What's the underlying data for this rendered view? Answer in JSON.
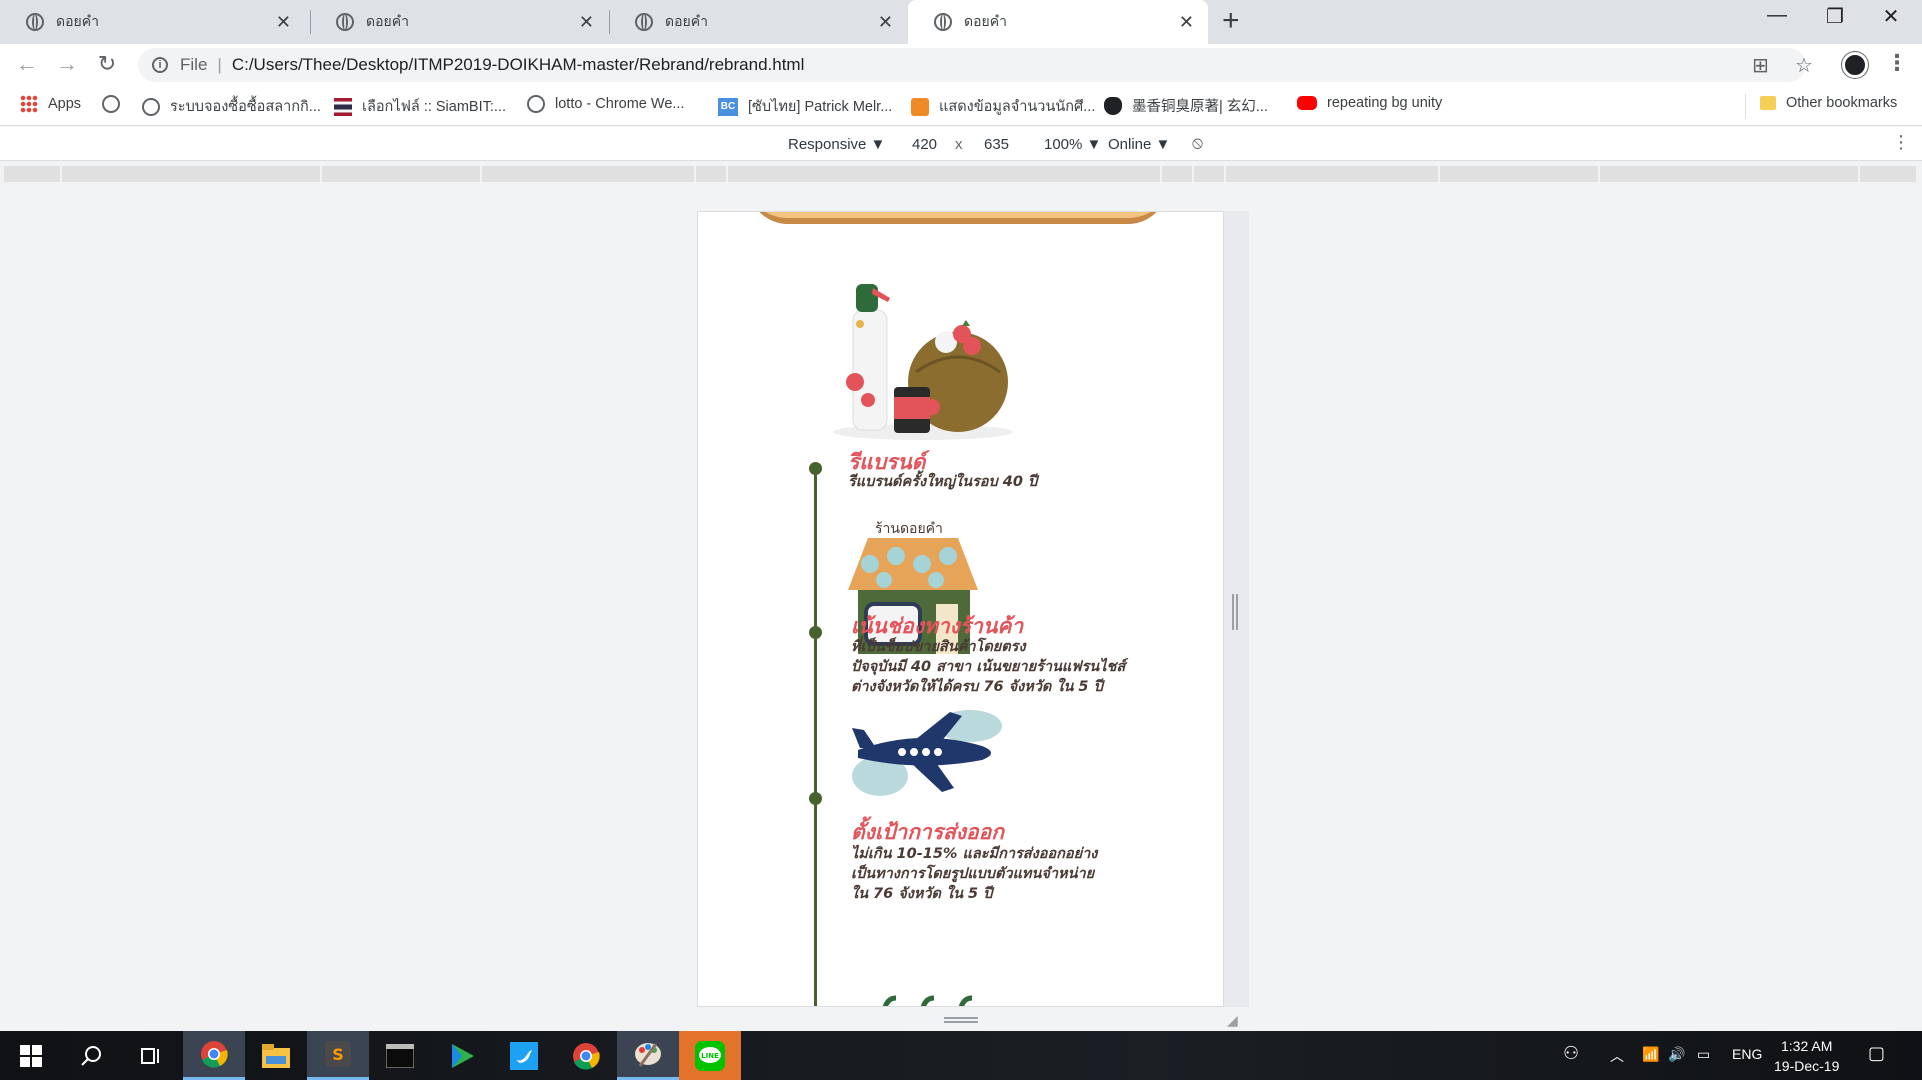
{
  "browser": {
    "tabs": [
      {
        "title": "ดอยคำ",
        "active": false
      },
      {
        "title": "ดอยคำ",
        "active": false
      },
      {
        "title": "ดอยคำ",
        "active": false
      },
      {
        "title": "ดอยคำ",
        "active": true
      }
    ],
    "new_tab_label": "+",
    "window_controls": {
      "minimize": "—",
      "restore": "❐",
      "close": "✕"
    },
    "address": {
      "scheme_label": "File",
      "url": "C:/Users/Thee/Desktop/ITMP2019-DOIKHAM-master/Rebrand/rebrand.html"
    },
    "bookmarks": [
      {
        "label": "Apps",
        "icon": "apps-icon"
      },
      {
        "label": "",
        "icon": "globe-icon"
      },
      {
        "label": "ระบบจองซื้อซื้อสลากกิ...",
        "icon": "globe-icon"
      },
      {
        "label": "เลือกไฟล์ :: SiamBIT:...",
        "icon": "thai-flag-icon"
      },
      {
        "label": "lotto - Chrome We...",
        "icon": "globe-icon"
      },
      {
        "label": "[ซับไทย] Patrick Melr...",
        "icon": "bc-icon"
      },
      {
        "label": "แสดงข้อมูลจำนวนนักศึ...",
        "icon": "orange-site-icon"
      },
      {
        "label": "墨香铜臭原著| 玄幻...",
        "icon": "cat-icon"
      },
      {
        "label": "repeating bg unity",
        "icon": "youtube-icon"
      }
    ],
    "other_bookmarks": "Other bookmarks"
  },
  "devtools": {
    "device": "Responsive ▼",
    "width": "420",
    "times": "x",
    "height": "635",
    "zoom": "100% ▼",
    "throttle": "Online ▼"
  },
  "page": {
    "shop_label": "ร้านดอยคำ",
    "timeline": [
      {
        "title": "รีแบรนด์",
        "desc": [
          "รีแบรนด์ครั้งใหญ่ในรอบ 40 ปี"
        ]
      },
      {
        "title": "เน้นช่องทางร้านค้า",
        "desc": [
          "ที่เป็นช็อปขายสินค้าโดยตรง",
          "ปัจจุบันมี 40 สาขา เน้นขยายร้านแฟรนไชส์",
          "ต่างจังหวัดให้ได้ครบ 76 จังหวัด ใน 5 ปี"
        ]
      },
      {
        "title": "ตั้งเป้าการส่งออก",
        "desc": [
          "ไม่เกิน 10-15% และมีการส่งออกอย่าง",
          "เป็นทางการโดยรูปแบบตัวแทนจำหน่าย",
          "ใน 76 จังหวัด ใน 5 ปี"
        ]
      }
    ]
  },
  "taskbar": {
    "apps": [
      "windows-start-icon",
      "search-icon",
      "task-view-icon",
      "chrome-icon",
      "file-explorer-icon",
      "sublime-icon",
      "terminal-icon",
      "media-player-icon",
      "twitter-icon",
      "chrome-icon",
      "paint-icon",
      "line-icon"
    ],
    "language": "ENG",
    "time": "1:32 AM",
    "date": "19-Dec-19"
  },
  "colors": {
    "accent_title": "#e2545a",
    "timeline": "#47612f",
    "banner": "#f3c380"
  }
}
